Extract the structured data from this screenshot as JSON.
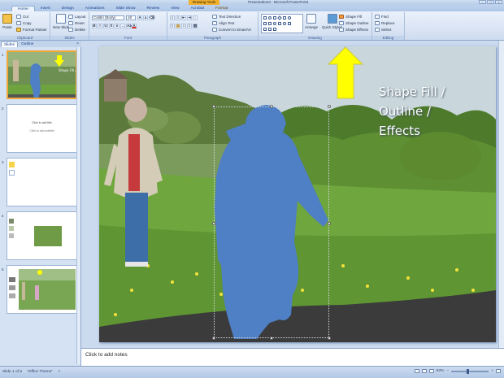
{
  "window": {
    "contextual_tab": "Drawing Tools",
    "title": "Presentation3 - Microsoft PowerPoint"
  },
  "tabs": [
    "Home",
    "Insert",
    "Design",
    "Animations",
    "Slide Show",
    "Review",
    "View",
    "Acrobat",
    "Format"
  ],
  "ribbon": {
    "clipboard": {
      "label": "Clipboard",
      "paste": "Paste",
      "cut": "Cut",
      "copy": "Copy",
      "format_painter": "Format Painter"
    },
    "slides": {
      "label": "Slides",
      "new_slide": "New Slide",
      "layout": "Layout",
      "reset": "Reset",
      "delete": "Delete"
    },
    "font": {
      "label": "Font",
      "font_name": "Calibri (Body)",
      "font_size": "18"
    },
    "paragraph": {
      "label": "Paragraph",
      "text_direction": "Text Direction",
      "align_text": "Align Text",
      "convert_smartart": "Convert to SmartArt"
    },
    "drawing": {
      "label": "Drawing",
      "arrange": "Arrange",
      "quick_styles": "Quick Styles",
      "shape_fill": "Shape Fill",
      "shape_outline": "Shape Outline",
      "shape_effects": "Shape Effects"
    },
    "editing": {
      "label": "Editing",
      "find": "Find",
      "replace": "Replace",
      "select": "Select"
    }
  },
  "slides_pane": {
    "tab_slides": "Slides",
    "tab_outline": "Outline",
    "close": "×",
    "thumbnails": [
      {
        "number": "1",
        "selected": true
      },
      {
        "number": "2",
        "title": "Click to add title",
        "subtitle": "Click to add subtitle"
      },
      {
        "number": "3"
      },
      {
        "number": "4"
      },
      {
        "number": "5"
      }
    ]
  },
  "slide": {
    "caption_line1": "Shape Fill /",
    "caption_line2": "Outline /",
    "caption_line3": "Effects"
  },
  "notes": {
    "placeholder": "Click to add notes"
  },
  "status": {
    "slide_info": "Slide 1 of 5",
    "theme": "\"Office Theme\"",
    "zoom": "63%"
  },
  "colors": {
    "accent_arrow": "#ffff00",
    "silhouette": "#4f7fc4",
    "selected_thumb": "#f0a73a"
  }
}
